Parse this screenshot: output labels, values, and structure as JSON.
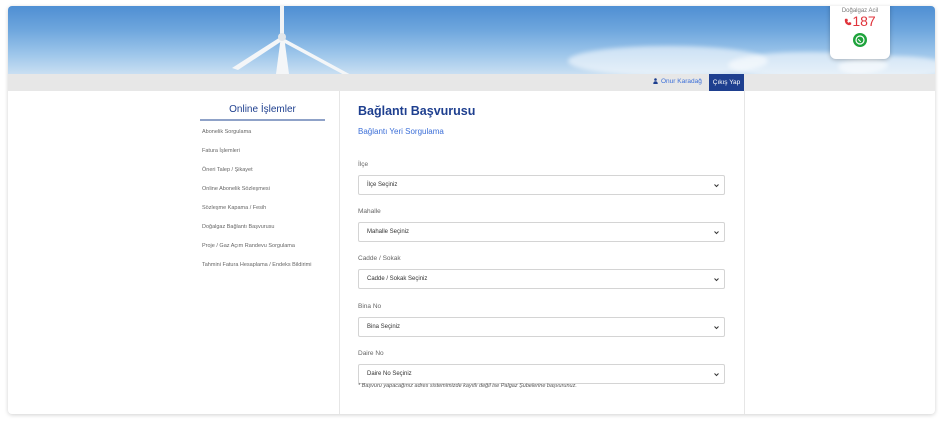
{
  "header": {
    "emergency_label": "Doğalgaz Acil",
    "emergency_number": "187",
    "icons": [
      "phone-icon",
      "whatsapp-icon",
      "person-icon"
    ]
  },
  "topbar": {
    "user_name": "Onur Karadağ",
    "logout_label": "Çıkış Yap"
  },
  "sidebar": {
    "title": "Online İşlemler",
    "items": [
      "Abonelik Sorgulama",
      "Fatura İşlemleri",
      "Öneri Talep / Şikayet",
      "Online Abonelik Sözleşmesi",
      "Sözleşme Kapama / Fesih",
      "Doğalgaz Bağlantı Başvurusu",
      "Proje / Gaz Açım Randevu Sorgulama",
      "Tahmini Fatura Hesaplama / Endeks Bildirimi"
    ]
  },
  "main": {
    "title": "Bağlantı Başvurusu",
    "subtitle": "Bağlantı Yeri Sorgulama",
    "fields": [
      {
        "label": "İlçe",
        "value": "İlçe Seçiniz"
      },
      {
        "label": "Mahalle",
        "value": "Mahalle Seçiniz"
      },
      {
        "label": "Cadde / Sokak",
        "value": "Cadde / Sokak Seçiniz"
      },
      {
        "label": "Bina No",
        "value": "Bina Seçiniz"
      },
      {
        "label": "Daire No",
        "value": "Daire No Seçiniz"
      }
    ],
    "note": "* Başvuru yapacağınız adres sistemimizde kayıtlı değil ise Palgaz Şubelerine başvurunuz."
  },
  "colors": {
    "brand": "#1e3f8f",
    "accent": "#3c6fd8",
    "emergency": "#e0343c",
    "whatsapp": "#1fa33c"
  }
}
